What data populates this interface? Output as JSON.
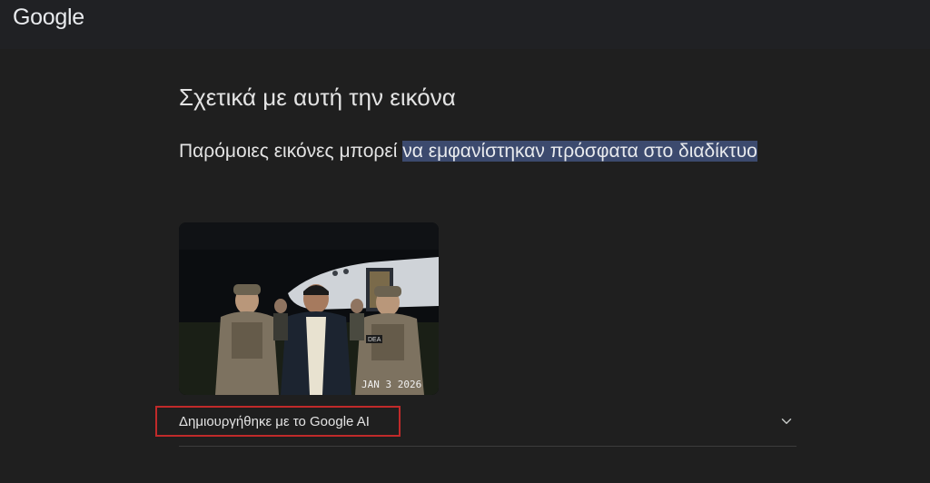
{
  "header": {
    "logo_text": "Google"
  },
  "main": {
    "title": "Σχετικά με αυτή την εικόνα",
    "subtitle_plain": "Παρόμοιες εικόνες μπορεί ",
    "subtitle_highlight": "να εμφανίστηκαν πρόσφατα στο διαδίκτυο",
    "image_timestamp": "JAN 3 2026",
    "image_patch_text": "DEA",
    "ai_credit_label": "Δημιουργήθηκε με το Google AI"
  },
  "icons": {
    "expand": "chevron-down-icon"
  },
  "colors": {
    "background": "#1f1f1f",
    "topbar": "#202124",
    "highlight": "#3c4a6e",
    "annotation_box": "#c02a2a"
  }
}
